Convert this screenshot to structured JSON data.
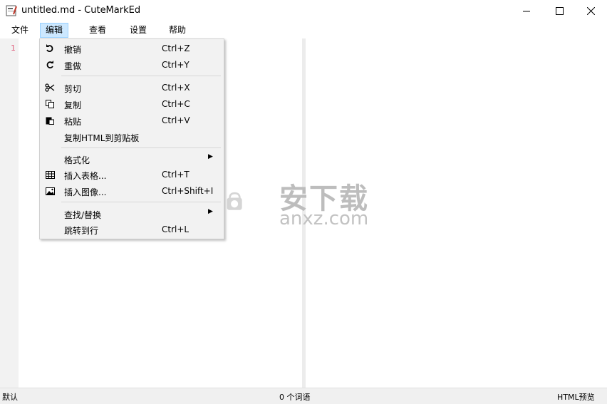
{
  "window": {
    "title": "untitled.md - CuteMarkEd",
    "icons": {
      "app": "app-icon",
      "minimize": "minimize-icon",
      "maximize": "maximize-icon",
      "close": "close-icon"
    }
  },
  "menubar": {
    "items": [
      "文件",
      "编辑",
      "查看",
      "设置",
      "帮助"
    ],
    "active_index": 1
  },
  "editor": {
    "line_number": "1"
  },
  "edit_menu": {
    "items": [
      {
        "label": "撤销",
        "shortcut": "Ctrl+Z",
        "icon": "undo-icon"
      },
      {
        "label": "重做",
        "shortcut": "Ctrl+Y",
        "icon": "redo-icon"
      },
      {
        "label": "剪切",
        "shortcut": "Ctrl+X",
        "icon": "cut-icon"
      },
      {
        "label": "复制",
        "shortcut": "Ctrl+C",
        "icon": "copy-icon"
      },
      {
        "label": "粘贴",
        "shortcut": "Ctrl+V",
        "icon": "paste-icon"
      },
      {
        "label": "复制HTML到剪贴板",
        "shortcut": "",
        "icon": ""
      },
      {
        "label": "格式化",
        "shortcut": "",
        "icon": "",
        "submenu": true
      },
      {
        "label": "插入表格...",
        "shortcut": "Ctrl+T",
        "icon": "table-icon"
      },
      {
        "label": "插入图像...",
        "shortcut": "Ctrl+Shift+I",
        "icon": "image-icon"
      },
      {
        "label": "查找/替换",
        "shortcut": "",
        "icon": "",
        "submenu": true
      },
      {
        "label": "跳转到行",
        "shortcut": "Ctrl+L",
        "icon": ""
      }
    ]
  },
  "statusbar": {
    "left": "默认",
    "center": "0 个词语",
    "right": "HTML预览"
  },
  "watermark": {
    "text": "安下载",
    "subtext": "anxz.com"
  }
}
